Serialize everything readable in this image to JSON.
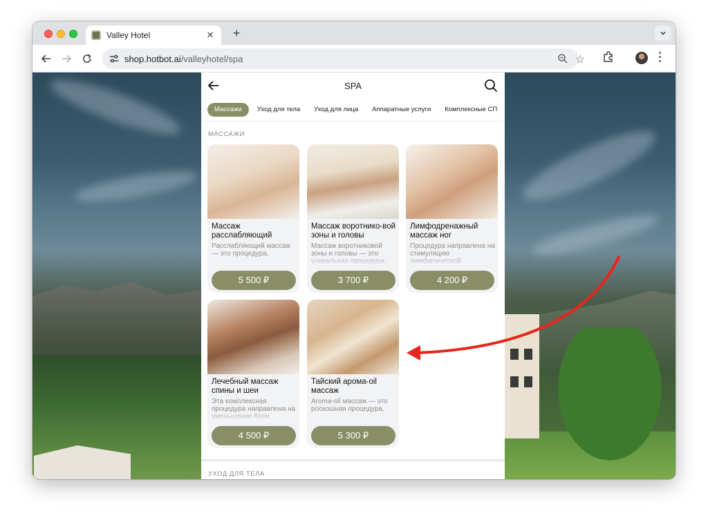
{
  "browser": {
    "tab_title": "Valley Hotel",
    "url_host": "shop.hotbot.ai",
    "url_path": "/valleyhotel/spa"
  },
  "app": {
    "title": "SPA",
    "categories": [
      {
        "label": "Массажи",
        "active": true
      },
      {
        "label": "Уход для тела",
        "active": false
      },
      {
        "label": "Уход для лица",
        "active": false
      },
      {
        "label": "Аппаратные услуги",
        "active": false
      },
      {
        "label": "Комплексные СП",
        "active": false
      }
    ],
    "section_massages": "МАССАЖИ",
    "section_body_care": "УХОД ДЛЯ ТЕЛА",
    "cards": [
      {
        "title": "Массаж расслабляющий",
        "description": "Расслабляющий массаж — это процедура,",
        "price": "5 500 ₽",
        "image": "relaxing-massage-photo"
      },
      {
        "title": "Массаж воротнико-вой зоны и головы",
        "description": "Массаж воротниковой зоны и головы — это уникальная процедура,",
        "price": "3 700 ₽",
        "image": "neck-head-massage-photo"
      },
      {
        "title": "Лимфодренажный массаж ног",
        "description": "Процедура направлена на стимуляцию лимфатической",
        "price": "4 200 ₽",
        "image": "lymph-drainage-photo"
      },
      {
        "title": "Лечебный массаж спины и шеи",
        "description": "Эта комплексная процедура направлена на уменьшение боли,",
        "price": "4 500 ₽",
        "image": "therapeutic-back-massage-photo"
      },
      {
        "title": "Тайский арома-oil массаж",
        "description": "Aroma-oil массаж — это роскошная процедура,",
        "price": "5 300 ₽",
        "image": "thai-aroma-oil-massage-photo"
      }
    ]
  },
  "colors": {
    "accent": "#8a8e67",
    "annotation_arrow": "#e8251b"
  }
}
